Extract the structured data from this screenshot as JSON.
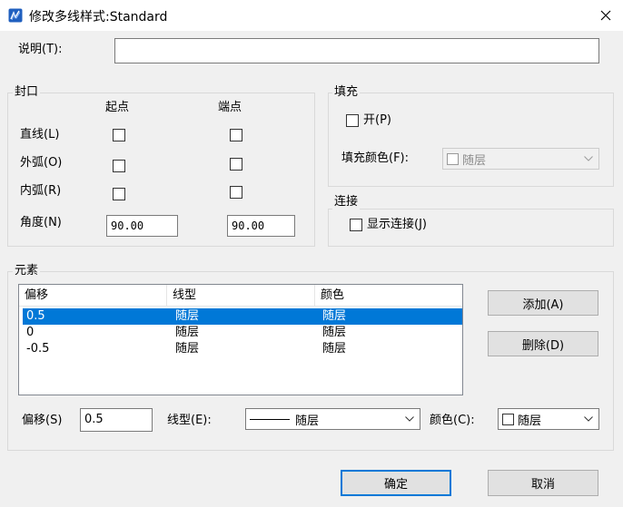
{
  "window": {
    "title": "修改多线样式:Standard"
  },
  "description": {
    "label": "说明(T):",
    "value": ""
  },
  "caps": {
    "title": "封口",
    "start_header": "起点",
    "end_header": "端点",
    "rows": [
      {
        "label": "直线(L)",
        "start_checked": false,
        "end_checked": false
      },
      {
        "label": "外弧(O)",
        "start_checked": false,
        "end_checked": false
      },
      {
        "label": "内弧(R)",
        "start_checked": false,
        "end_checked": false
      }
    ],
    "angle": {
      "label": "角度(N)",
      "start_value": "90.00",
      "end_value": "90.00"
    }
  },
  "fill": {
    "title": "填充",
    "on_label": "开(P)",
    "on_checked": false,
    "color_label": "填充颜色(F):",
    "color_value": "随层"
  },
  "joints": {
    "title": "连接",
    "show_label": "显示连接(J)",
    "show_checked": false
  },
  "elements": {
    "title": "元素",
    "columns": [
      "偏移",
      "线型",
      "颜色"
    ],
    "rows": [
      {
        "offset": "0.5",
        "linetype": "随层",
        "color": "随层",
        "selected": true
      },
      {
        "offset": "0",
        "linetype": "随层",
        "color": "随层",
        "selected": false
      },
      {
        "offset": "-0.5",
        "linetype": "随层",
        "color": "随层",
        "selected": false
      }
    ],
    "add_label": "添加(A)",
    "delete_label": "删除(D)",
    "offset_label": "偏移(S)",
    "offset_value": "0.5",
    "linetype_label": "线型(E):",
    "linetype_value": "随层",
    "color_label": "颜色(C):",
    "color_value": "随层"
  },
  "footer": {
    "ok_label": "确定",
    "cancel_label": "取消"
  },
  "colors": {
    "selection": "#0078d7",
    "dialog_bg": "#f0f0f0",
    "app_icon": "#1f5fbf"
  }
}
